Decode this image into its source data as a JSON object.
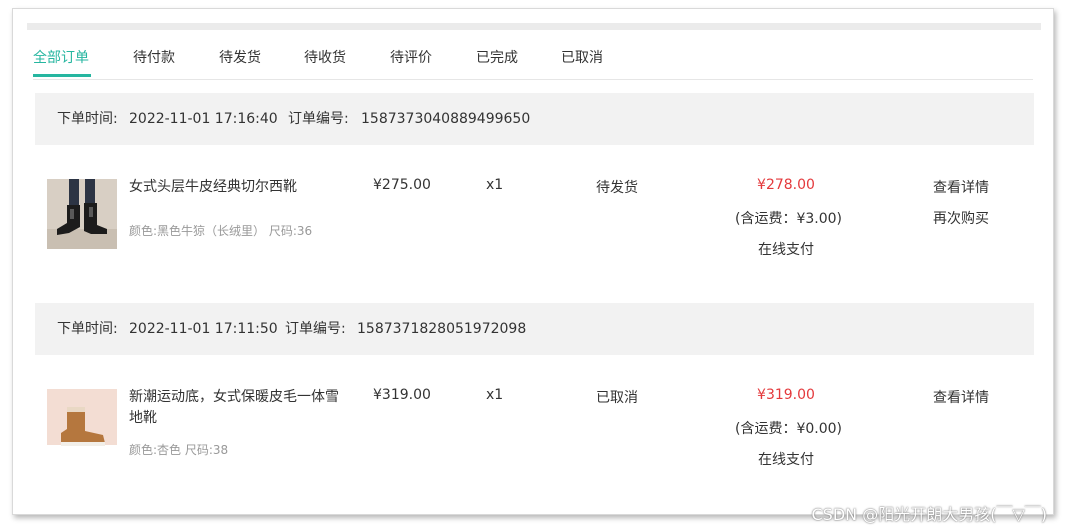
{
  "tabs": [
    "全部订单",
    "待付款",
    "待发货",
    "待收货",
    "待评价",
    "已完成",
    "已取消"
  ],
  "orders": [
    {
      "time_label": "下单时间:",
      "time": "2022-11-01 17:16:40",
      "no_label": "订单编号:",
      "no": "1587373040889499650",
      "product_name": "女式头层牛皮经典切尔西靴",
      "spec": "颜色:黑色牛猄（长绒里） 尺码:36",
      "price": "¥275.00",
      "qty": "x1",
      "status": "待发货",
      "total": "¥278.00",
      "shipping": "(含运费：¥3.00)",
      "pay": "在线支付",
      "actions": [
        "查看详情",
        "再次购买"
      ]
    },
    {
      "time_label": "下单时间:",
      "time": "2022-11-01 17:11:50",
      "no_label": "订单编号:",
      "no": "1587371828051972098",
      "product_name": "新潮运动底，女式保暖皮毛一体雪地靴",
      "spec": "颜色:杏色 尺码:38",
      "price": "¥319.00",
      "qty": "x1",
      "status": "已取消",
      "total": "¥319.00",
      "shipping": "(含运费：¥0.00)",
      "pay": "在线支付",
      "actions": [
        "查看详情"
      ]
    }
  ],
  "watermark": "CSDN @阳光开朗大男孩(￣▽￣)",
  "colors": {
    "accent": "#26b6a0",
    "price_red": "#e4393c"
  }
}
